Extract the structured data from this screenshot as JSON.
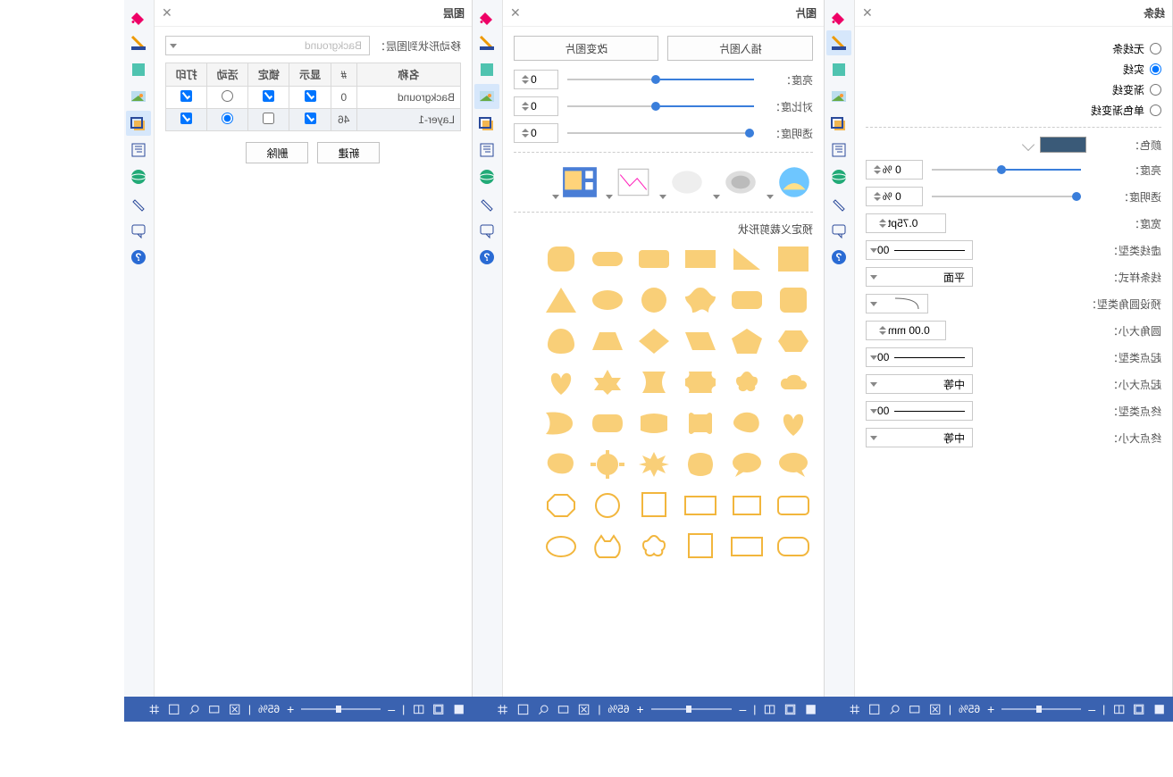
{
  "panels": {
    "line": {
      "title": "线条",
      "radio_none": "无线条",
      "radio_solid": "实线",
      "radio_gradient": "渐变线",
      "radio_mono_gradient": "单色渐变线",
      "color_label": "颜色：",
      "brightness_label": "亮度：",
      "brightness_val": "0 %",
      "transparency_label": "透明度：",
      "transparency_val": "0 %",
      "width_label": "宽度：",
      "width_val": "0.75pt",
      "dash_label": "虚线类型：",
      "dash_val": "00",
      "line_style_label": "线条样式：",
      "line_style_val": "平面",
      "round_type_label": "预设圆角类型：",
      "round_size_label": "圆角大小：",
      "round_size_val": "0.00 mm",
      "start_type_label": "起点类型：",
      "start_type_val": "00",
      "start_size_label": "起点大小：",
      "start_size_val": "中等",
      "end_type_label": "终点类型：",
      "end_type_val": "00",
      "end_size_label": "终点大小：",
      "end_size_val": "中等"
    },
    "image": {
      "title": "图片",
      "insert_btn": "插入图片",
      "change_btn": "改变图片",
      "brightness": "亮度：",
      "contrast": "对比度：",
      "transparency": "透明度：",
      "val0": "0",
      "crop_label": "预定义裁剪形状"
    },
    "layers": {
      "title": "图层",
      "move_label": "移动形状到图层：",
      "move_val": "Background",
      "h_name": "名称",
      "h_count": "#",
      "h_show": "显示",
      "h_lock": "锁定",
      "h_active": "活动",
      "h_print": "打印",
      "row0_name": "Background",
      "row0_count": "0",
      "row1_name": "Layer-1",
      "row1_count": "46",
      "btn_new": "新建",
      "btn_del": "删除"
    }
  },
  "status": {
    "zoom": "65%"
  }
}
